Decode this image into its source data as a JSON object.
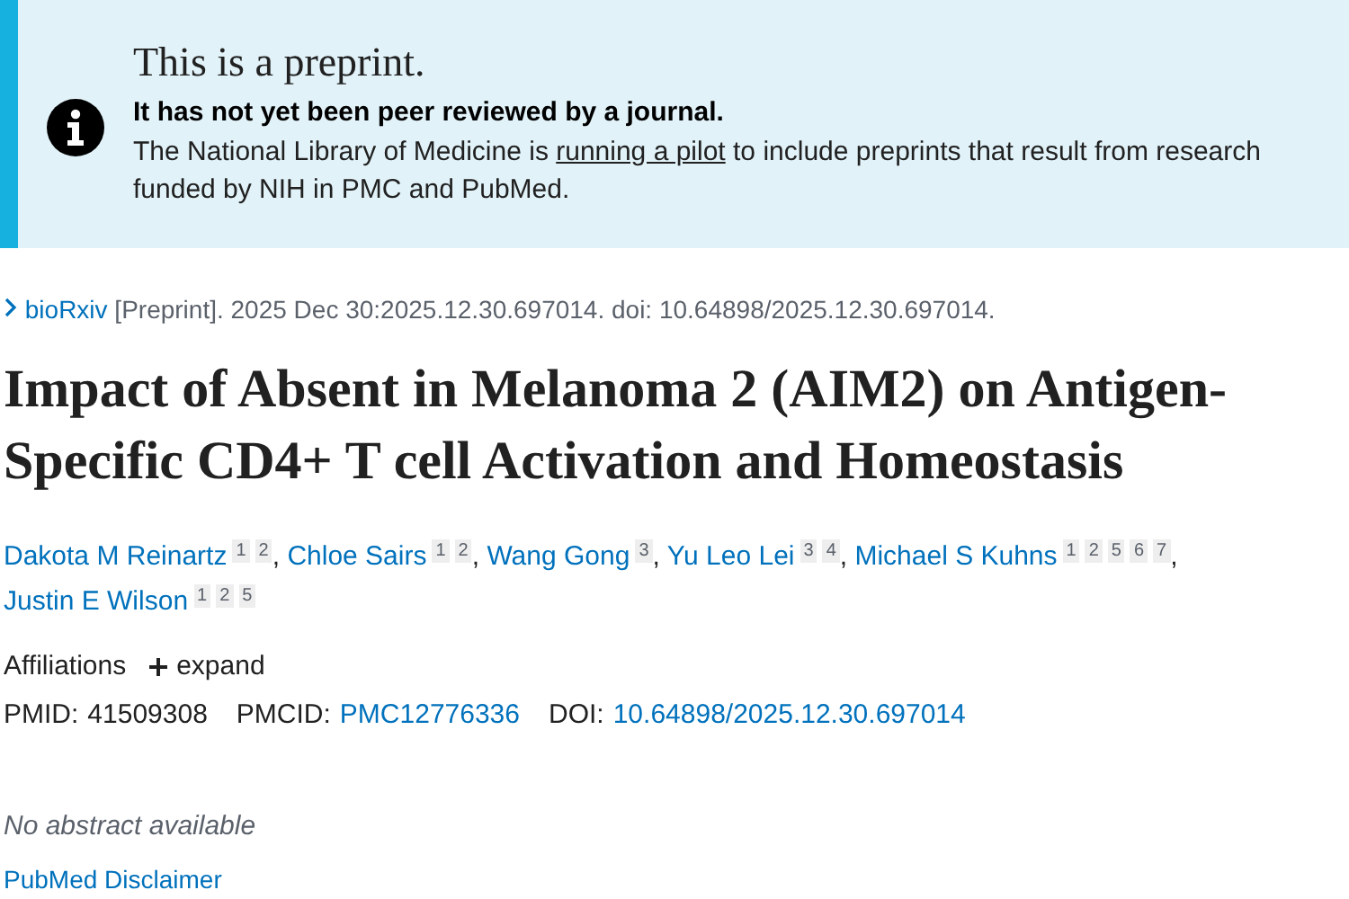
{
  "notice": {
    "title": "This is a preprint.",
    "subtitle": "It has not yet been peer reviewed by a journal.",
    "body": [
      "The National Library of Medicine is ",
      "running a pilot",
      " to include preprints that result from research funded by NIH in PMC and PubMed."
    ]
  },
  "source": {
    "journal": "bioRxiv",
    "citation": "[Preprint]. 2025 Dec 30:2025.12.30.697014. doi: 10.64898/2025.12.30.697014."
  },
  "title": "Impact of Absent in Melanoma 2 (AIM2) on Antigen-Specific CD4+ T cell Activation and Homeostasis",
  "authors": [
    {
      "name": "Dakota M Reinartz",
      "affiliations": [
        "1",
        "2"
      ],
      "separator": ","
    },
    {
      "name": "Chloe Sairs",
      "affiliations": [
        "1",
        "2"
      ],
      "separator": ","
    },
    {
      "name": "Wang Gong",
      "affiliations": [
        "3"
      ],
      "separator": ","
    },
    {
      "name": "Yu Leo Lei",
      "affiliations": [
        "3",
        "4"
      ],
      "separator": ","
    },
    {
      "name": "Michael S Kuhns",
      "affiliations": [
        "1",
        "2",
        "5",
        "6",
        "7"
      ],
      "separator": ","
    },
    {
      "name": "Justin E Wilson",
      "affiliations": [
        "1",
        "2",
        "5"
      ]
    }
  ],
  "affiliations": {
    "label": "Affiliations",
    "toggle": "expand",
    "expanded": false
  },
  "identifiers": [
    {
      "label": "PMID:",
      "value": "41509308",
      "link": false
    },
    {
      "label": "PMCID:",
      "value": "PMC12776336",
      "link": true
    },
    {
      "label": "DOI:",
      "value": "10.64898/2025.12.30.697014",
      "link": true
    }
  ],
  "abstract": "No abstract available",
  "disclaimer": "PubMed Disclaimer"
}
